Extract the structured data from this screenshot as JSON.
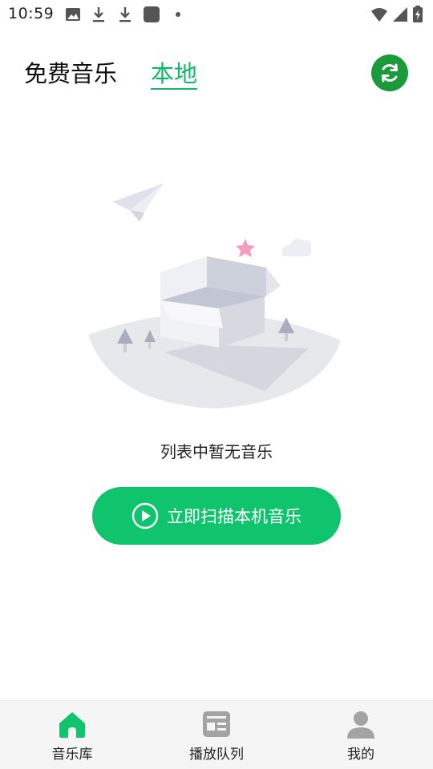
{
  "status_bar": {
    "time": "10:59",
    "icons": [
      "image-icon",
      "download-icon",
      "download-icon",
      "app-square-icon",
      "dot-icon",
      "wifi-icon",
      "signal-icon",
      "battery-charging-icon"
    ]
  },
  "header": {
    "tabs": [
      {
        "label": "免费音乐",
        "active": false
      },
      {
        "label": "本地",
        "active": true
      }
    ],
    "refresh_icon": "refresh-icon"
  },
  "empty_state": {
    "message": "列表中暂无音乐",
    "scan_button_label": "立即扫描本机音乐",
    "scan_icon": "play-circle-icon"
  },
  "bottom_nav": {
    "items": [
      {
        "label": "音乐库",
        "icon": "home-icon",
        "active": true
      },
      {
        "label": "播放队列",
        "icon": "queue-icon",
        "active": false
      },
      {
        "label": "我的",
        "icon": "user-icon",
        "active": false
      }
    ]
  },
  "colors": {
    "accent": "#12b76a",
    "scan_button": "#10c46e",
    "refresh_button": "#1a9a3a",
    "nav_bg": "#f5f5f5",
    "inactive_icon": "#9e9e9e"
  }
}
